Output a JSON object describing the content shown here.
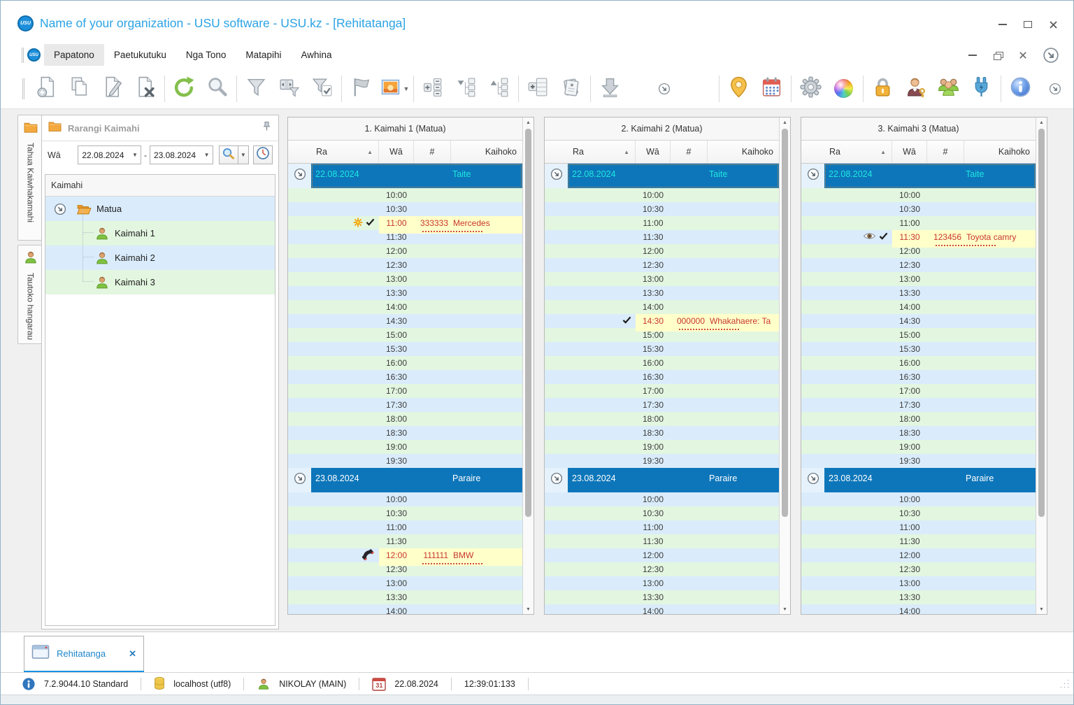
{
  "window": {
    "title": "Name of your organization - USU software - USU.kz - [Rehitatanga]",
    "logo_text": "USU"
  },
  "menu": {
    "items": [
      "Papatono",
      "Paetukutuku",
      "Nga Tono",
      "Matapihi",
      "Awhina"
    ],
    "active_index": 0
  },
  "toolbar": {
    "left_groups": [
      [
        "new-document",
        "copy-document",
        "edit-document",
        "delete-document"
      ],
      [
        "refresh",
        "search"
      ],
      [
        "filter",
        "filter-columns",
        "filter-confirm"
      ],
      [
        "flag",
        "image-preview"
      ],
      [
        "expand-groups",
        "collapse-tree",
        "expand-tree"
      ],
      [
        "add-record",
        "print-documents"
      ],
      [
        "download"
      ]
    ],
    "overflow_icon": "chevron-circle",
    "right_groups": [
      [
        "map-pin",
        "calendar"
      ],
      [
        "settings-gear",
        "color-wheel"
      ],
      [
        "lock",
        "user-key",
        "user-group",
        "plugin"
      ],
      [
        "info"
      ]
    ],
    "end_icon": "chevron-circle"
  },
  "sidebar_tabs": [
    {
      "label": "Tahua Kaiwhakamahi",
      "icon": "folder-icon"
    },
    {
      "label": "Tautoko hangarau",
      "icon": "person-icon"
    }
  ],
  "left_panel": {
    "title": "Rarangi Kaimahi",
    "filter_label": "Wā",
    "date_from": "22.08.2024",
    "date_to": "23.08.2024",
    "range_dash": "-",
    "tree_header": "Kaimahi",
    "tree": [
      {
        "label": "Matua",
        "icon": "open-folder-icon",
        "level": 0,
        "expandable": true
      },
      {
        "label": "Kaimahi 1",
        "icon": "person-icon",
        "level": 1
      },
      {
        "label": "Kaimahi 2",
        "icon": "person-icon",
        "level": 1
      },
      {
        "label": "Kaimahi 3",
        "icon": "person-icon",
        "level": 1
      }
    ]
  },
  "schedule": {
    "panels": [
      {
        "title": "1. Kaimahi 1 (Matua)"
      },
      {
        "title": "2. Kaimahi 2 (Matua)"
      },
      {
        "title": "3. Kaimahi 3 (Matua)"
      }
    ],
    "columns": {
      "date": "Ra",
      "time": "Wā",
      "number": "#",
      "client": "Kaihoko"
    },
    "days": [
      {
        "date": "22.08.2024",
        "weekday": "Taite",
        "selected": true,
        "times": [
          "10:00",
          "10:30",
          "11:00",
          "11:30",
          "12:00",
          "12:30",
          "13:00",
          "13:30",
          "14:00",
          "14:30",
          "15:00",
          "15:30",
          "16:00",
          "16:30",
          "17:00",
          "17:30",
          "18:00",
          "18:30",
          "19:00",
          "19:30"
        ]
      },
      {
        "date": "23.08.2024",
        "weekday": "Paraire",
        "selected": false,
        "times": [
          "10:00",
          "10:30",
          "11:00",
          "11:30",
          "12:00",
          "12:30",
          "13:00",
          "13:30",
          "14:00"
        ]
      }
    ],
    "appointments": [
      {
        "panel": 0,
        "day": 0,
        "time": "11:00",
        "number": "333333",
        "client": "Mercedes",
        "icons": [
          "star-icon",
          "check-icon"
        ]
      },
      {
        "panel": 1,
        "day": 0,
        "time": "14:30",
        "number": "000000",
        "client": "Whakahaere: Ta",
        "icons": [
          "document-icon",
          "check-icon"
        ]
      },
      {
        "panel": 2,
        "day": 0,
        "time": "11:30",
        "number": "123456",
        "client": "Toyota camry",
        "icons": [
          "eye-icon",
          "check-icon"
        ]
      },
      {
        "panel": 0,
        "day": 1,
        "time": "12:00",
        "number": "111111",
        "client": "BMW",
        "icons": [
          "phone-icon"
        ]
      }
    ]
  },
  "bottom_tab": {
    "label": "Rehitatanga",
    "close": "✕"
  },
  "status_bar": {
    "version": "7.2.9044.10 Standard",
    "database": "localhost (utf8)",
    "user": "NIKOLAY (MAIN)",
    "date": "22.08.2024",
    "time": "12:39:01:133",
    "calendar_day": "31"
  },
  "colors": {
    "accent_blue": "#1593e3",
    "title_text": "#2ba3e4",
    "band_blue": "#0d76ba",
    "selected_band_text": "#1fe8e0",
    "row_green": "#e3f6e0",
    "row_blue": "#daecfb",
    "appointment_yellow": "#ffffc9",
    "appointment_text": "#c9372e"
  }
}
